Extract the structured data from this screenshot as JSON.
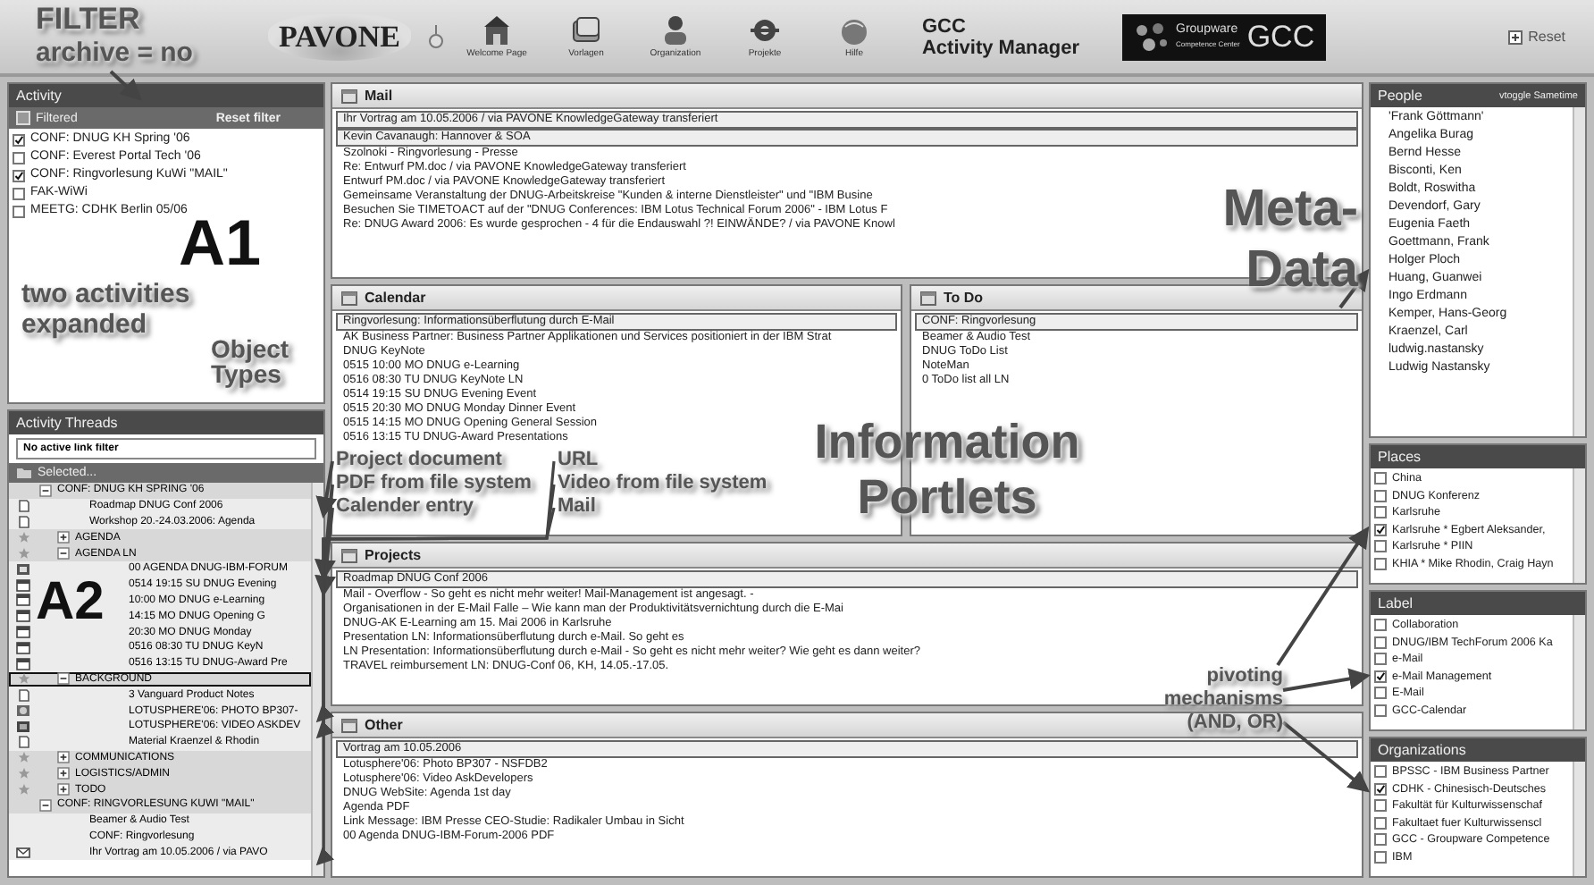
{
  "header": {
    "logo": "PAVONE",
    "toolbar": [
      {
        "label": "Welcome Page",
        "kind": "house"
      },
      {
        "label": "Vorlagen",
        "kind": "template"
      },
      {
        "label": "Organization",
        "kind": "people"
      },
      {
        "label": "Projekte",
        "kind": "project"
      },
      {
        "label": "Hilfe",
        "kind": "help"
      }
    ],
    "title_line1": "GCC",
    "title_line2": "Activity Manager",
    "badge": {
      "word": "Groupware",
      "sub": "Competence Center",
      "abbr": "GCC"
    },
    "reset": "Reset"
  },
  "activity": {
    "title": "Activity",
    "filter": "Filtered",
    "reset_filter": "Reset filter",
    "items": [
      {
        "label": "CONF: DNUG KH Spring '06",
        "checked": true
      },
      {
        "label": "CONF: Everest Portal Tech '06",
        "checked": false
      },
      {
        "label": "CONF: Ringvorlesung KuWi \"MAIL\"",
        "checked": true
      },
      {
        "label": "FAK-WiWi",
        "checked": false
      },
      {
        "label": "MEETG: CDHK Berlin 05/06",
        "checked": false
      }
    ]
  },
  "threads": {
    "title": "Activity Threads",
    "link_filter": "No active link filter",
    "selected_label": "Selected...",
    "items": [
      {
        "label": "CONF: DNUG KH SPRING '06",
        "kind": "group",
        "expanded": true,
        "selected": false,
        "children": [
          {
            "label": "Roadmap DNUG Conf 2006",
            "kind": "doc",
            "selected": false
          },
          {
            "label": "Workshop 20.-24.03.2006: Agenda",
            "kind": "doc",
            "selected": false
          },
          {
            "label": "AGENDA",
            "kind": "category",
            "expanded": false,
            "selected": false
          },
          {
            "label": "AGENDA LN",
            "kind": "category",
            "expanded": true,
            "selected": false,
            "children": [
              {
                "label": "00 AGENDA DNUG-IBM-FORUM",
                "kind": "pdf",
                "selected": false
              },
              {
                "label": "0514 19:15 SU DNUG Evening",
                "kind": "calendar",
                "selected": false
              },
              {
                "label": "10:00 MO DNUG e-Learning",
                "kind": "calendar",
                "selected": false
              },
              {
                "label": "14:15 MO DNUG Opening G",
                "kind": "calendar",
                "selected": false
              },
              {
                "label": "20:30 MO DNUG Monday",
                "kind": "calendar",
                "selected": false
              },
              {
                "label": "0516 08:30 TU DNUG KeyN",
                "kind": "calendar",
                "selected": false
              },
              {
                "label": "0516 13:15 TU DNUG-Award Pre",
                "kind": "calendar",
                "selected": false
              }
            ]
          },
          {
            "label": "BACKGROUND",
            "kind": "category",
            "expanded": true,
            "selected": true,
            "children": [
              {
                "label": "3 Vanguard Product Notes",
                "kind": "doc",
                "selected": false
              },
              {
                "label": "LOTUSPHERE'06: PHOTO BP307-",
                "kind": "url",
                "selected": false
              },
              {
                "label": "LOTUSPHERE'06: VIDEO ASKDEV",
                "kind": "video",
                "selected": false
              },
              {
                "label": "Material Kraenzel & Rhodin",
                "kind": "doc",
                "selected": false
              }
            ]
          },
          {
            "label": "COMMUNICATIONS",
            "kind": "category",
            "expanded": false,
            "selected": false
          },
          {
            "label": "LOGISTICS/ADMIN",
            "kind": "category",
            "expanded": false,
            "selected": false
          },
          {
            "label": "TODO",
            "kind": "category",
            "expanded": false,
            "selected": false
          }
        ]
      },
      {
        "label": "CONF: RINGVORLESUNG KUWI \"MAIL\"",
        "kind": "group",
        "expanded": true,
        "selected": false,
        "children": [
          {
            "label": "Beamer & Audio Test",
            "kind": "plain",
            "selected": false
          },
          {
            "label": "CONF: Ringvorlesung",
            "kind": "plain",
            "selected": false
          },
          {
            "label": "Ihr Vortrag am 10.05.2006 / via PAVO",
            "kind": "mail",
            "selected": false
          }
        ]
      }
    ]
  },
  "portlets": {
    "mail": {
      "title": "Mail",
      "items": [
        {
          "text": "Ihr Vortrag am 10.05.2006 / via PAVONE KnowledgeGateway transferiert",
          "selected": true
        },
        {
          "text": "Kevin Cavanaugh: Hannover & SOA",
          "selected": true
        },
        {
          "text": "Szolnoki - Ringvorlesung - Presse",
          "selected": false
        },
        {
          "text": "Re: Entwurf PM.doc / via PAVONE KnowledgeGateway transferiert",
          "selected": false
        },
        {
          "text": "Entwurf PM.doc / via PAVONE KnowledgeGateway transferiert",
          "selected": false
        },
        {
          "text": "Gemeinsame Veranstaltung der DNUG-Arbeitskreise \"Kunden & interne Dienstleister\" und \"IBM Busine",
          "selected": false
        },
        {
          "text": "Besuchen Sie TIMETOACT auf der \"DNUG Conferences: IBM Lotus Technical Forum 2006\" - IBM Lotus F",
          "selected": false
        },
        {
          "text": "Re: DNUG Award 2006: Es wurde gesprochen - 4 für die Endauswahl ?! EINWÄNDE? / via PAVONE Knowl",
          "selected": false
        }
      ]
    },
    "calendar": {
      "title": "Calendar",
      "items": [
        {
          "text": "Ringvorlesung: Informationsüberflutung durch E-Mail",
          "selected": true
        },
        {
          "text": "AK Business Partner: Business Partner Applikationen und Services positioniert in der IBM Strat",
          "selected": false
        },
        {
          "text": "DNUG KeyNote",
          "selected": false
        },
        {
          "text": "0515 10:00 MO DNUG e-Learning",
          "selected": false
        },
        {
          "text": "0516 08:30 TU DNUG KeyNote LN",
          "selected": false
        },
        {
          "text": "0514 19:15 SU DNUG Evening Event",
          "selected": false
        },
        {
          "text": "0515 20:30 MO DNUG Monday Dinner Event",
          "selected": false
        },
        {
          "text": "0515 14:15 MO DNUG Opening General Session",
          "selected": false
        },
        {
          "text": "0516 13:15 TU DNUG-Award Presentations",
          "selected": false
        }
      ]
    },
    "todo": {
      "title": "To Do",
      "items": [
        {
          "text": "CONF: Ringvorlesung",
          "selected": true
        },
        {
          "text": "Beamer & Audio Test",
          "selected": false
        },
        {
          "text": "DNUG ToDo List",
          "selected": false
        },
        {
          "text": "NoteMan",
          "selected": false
        },
        {
          "text": "0 ToDo list all LN",
          "selected": false
        }
      ]
    },
    "projects": {
      "title": "Projects",
      "items": [
        {
          "text": "Roadmap DNUG Conf 2006",
          "selected": true
        },
        {
          "text": "Mail - Overflow - So geht es nicht mehr weiter! Mail-Management ist angesagt. -",
          "selected": false
        },
        {
          "text": "Organisationen in der E-Mail Falle – Wie kann man der Produktivitätsvernichtung durch die E-Mai",
          "selected": false
        },
        {
          "text": "DNUG-AK E-Learning am 15. Mai 2006 in Karlsruhe",
          "selected": false
        },
        {
          "text": "Presentation LN: Informationsüberflutung durch e-Mail. So geht es",
          "selected": false
        },
        {
          "text": "LN Presentation: Informationsüberflutung durch e-Mail - So geht es nicht mehr weiter? Wie geht es dann weiter?",
          "selected": false
        },
        {
          "text": "TRAVEL reimbursement LN: DNUG-Conf 06, KH, 14.05.-17.05.",
          "selected": false
        }
      ]
    },
    "other": {
      "title": "Other",
      "items": [
        {
          "text": "Vortrag am 10.05.2006",
          "selected": true
        },
        {
          "text": "Lotusphere'06: Photo BP307 - NSFDB2",
          "selected": false
        },
        {
          "text": "Lotusphere'06: Video AskDevelopers",
          "selected": false
        },
        {
          "text": "DNUG WebSite: Agenda 1st day",
          "selected": false
        },
        {
          "text": "Agenda PDF",
          "selected": false
        },
        {
          "text": "Link Message: IBM Presse CEO-Studie: Radikaler Umbau in Sicht",
          "selected": false
        },
        {
          "text": "00 Agenda DNUG-IBM-Forum-2006 PDF",
          "selected": false
        }
      ]
    }
  },
  "people": {
    "title": "People",
    "toggle": "vtoggle Sametime",
    "items": [
      "'Frank Göttmann'",
      "Angelika Burag",
      "Bernd Hesse",
      "Bisconti, Ken",
      "Boldt, Roswitha",
      "Devendorf, Gary",
      "Eugenia Faeth",
      "Goettmann, Frank",
      "Holger Ploch",
      "Huang, Guanwei",
      "Ingo Erdmann",
      "Kemper, Hans-Georg",
      "Kraenzel, Carl",
      "ludwig.nastansky",
      "Ludwig Nastansky"
    ]
  },
  "facets": [
    {
      "title": "Places",
      "items": [
        {
          "label": "China",
          "checked": false
        },
        {
          "label": "DNUG Konferenz",
          "checked": false
        },
        {
          "label": "Karlsruhe",
          "checked": false
        },
        {
          "label": "Karlsruhe * Egbert Aleksander,",
          "checked": true
        },
        {
          "label": "Karlsruhe * PIIN",
          "checked": false
        },
        {
          "label": "KHIA * Mike Rhodin, Craig Hayn",
          "checked": false
        }
      ]
    },
    {
      "title": "Label",
      "items": [
        {
          "label": "Collaboration",
          "checked": false
        },
        {
          "label": "DNUG/IBM TechForum 2006 Ka",
          "checked": false
        },
        {
          "label": "e-Mail",
          "checked": false
        },
        {
          "label": "e-Mail Management",
          "checked": true
        },
        {
          "label": "E-Mail",
          "checked": false
        },
        {
          "label": "GCC-Calendar",
          "checked": false
        }
      ]
    },
    {
      "title": "Organizations",
      "items": [
        {
          "label": "BPSSC - IBM Business Partner",
          "checked": false
        },
        {
          "label": "CDHK - Chinesisch-Deutsches",
          "checked": true
        },
        {
          "label": "Fakultät für Kulturwissenschaf",
          "checked": false
        },
        {
          "label": "Fakultaet fuer Kulturwissenscl",
          "checked": false
        },
        {
          "label": "GCC - Groupware Competence",
          "checked": false
        },
        {
          "label": "IBM",
          "checked": false
        }
      ]
    }
  ],
  "annotations": {
    "filter": "FILTER",
    "filter_sub": "archive = no",
    "a1": "A1",
    "a1_note": "two activities expanded",
    "object_types": "Object Types",
    "types": [
      "Project document",
      "PDF from file system",
      "Calender entry",
      "URL",
      "Video from file system",
      "Mail"
    ],
    "a2": "A2",
    "portlets": "Information Portlets",
    "metadata": "Meta-Data",
    "pivoting": "pivoting mechanisms (AND, OR)"
  }
}
